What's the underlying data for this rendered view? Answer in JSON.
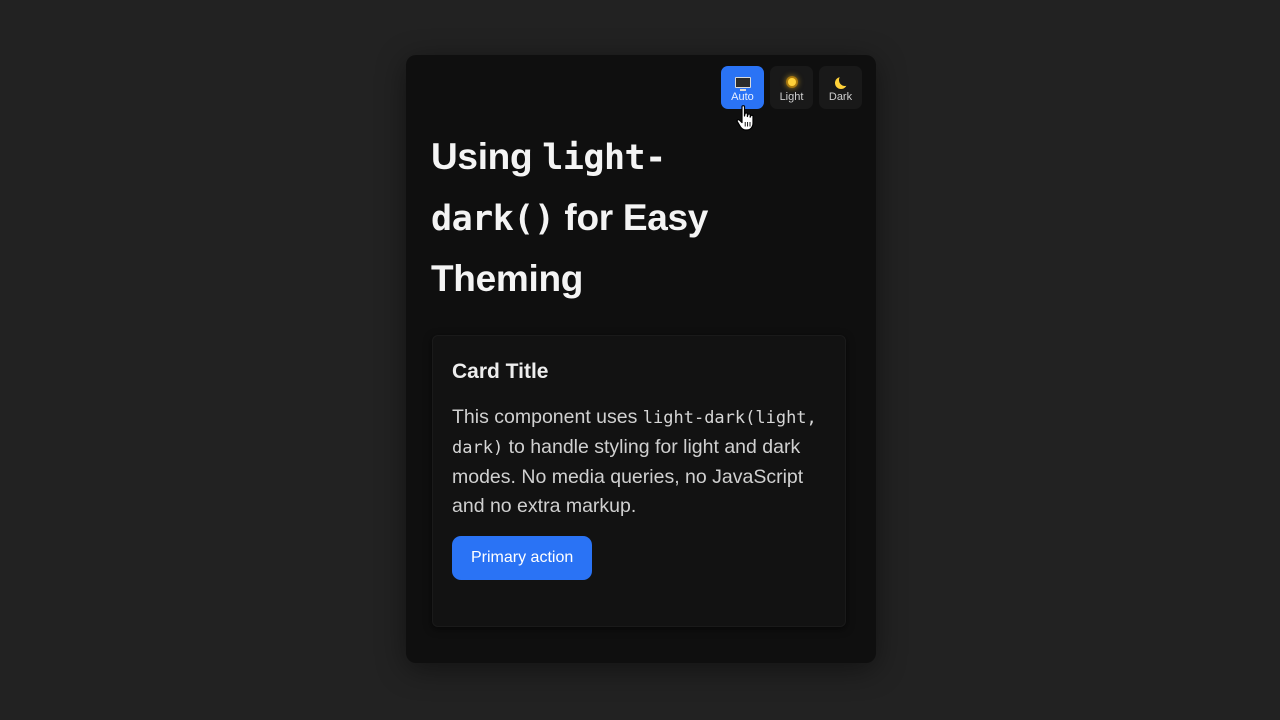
{
  "theme_switcher": {
    "options": [
      {
        "label": "Auto",
        "icon": "monitor-icon",
        "active": true
      },
      {
        "label": "Light",
        "icon": "sun-icon",
        "active": false
      },
      {
        "label": "Dark",
        "icon": "moon-icon",
        "active": false
      }
    ]
  },
  "heading": {
    "code_part": "light-dark()",
    "prefix": "Using",
    "suffix": "for Easy Theming"
  },
  "card": {
    "title": "Card Title",
    "body_before": "This component uses",
    "body_code": "light-dark(light, dark)",
    "body_after": "to handle styling for light and dark modes. No media queries, no JavaScript and no extra markup.",
    "button_label": "Primary action"
  },
  "colors": {
    "page_background": "#222222",
    "panel_background": "#0f0f0f",
    "accent": "#2a73f5"
  }
}
